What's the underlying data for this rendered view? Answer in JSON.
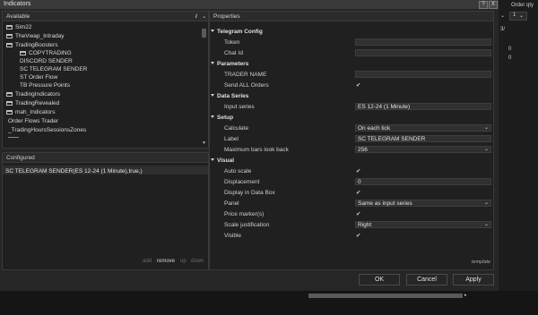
{
  "window": {
    "title": "Indicators",
    "help_label": "?",
    "close_label": "X"
  },
  "right_strip": {
    "order_qty_label": "Order qty",
    "qty_value": "1",
    "rows": [
      "3/",
      "0",
      "0"
    ]
  },
  "available": {
    "header": "Available",
    "header_icon": "i-info-icon",
    "items": [
      {
        "label": "Sim22",
        "folder": true
      },
      {
        "label": "TheVwap_Intraday",
        "folder": true
      },
      {
        "label": "TradingBoosters",
        "folder": true
      },
      {
        "label": "COPYTRADING",
        "folder": true
      },
      {
        "label": "DISCORD SENDER",
        "folder": false
      },
      {
        "label": "SC TELEGRAM SENDER",
        "folder": false
      },
      {
        "label": "ST Order Flow",
        "folder": false
      },
      {
        "label": "TB Pressure Points",
        "folder": false
      },
      {
        "label": "TradingIndicators",
        "folder": true
      },
      {
        "label": "TradingRevealed",
        "folder": true
      },
      {
        "label": "mah_Indicators",
        "folder": true
      },
      {
        "label": "Order Flows Trader",
        "folder": false
      },
      {
        "label": "_TradingHoursSessionsZones",
        "folder": false
      }
    ]
  },
  "configured": {
    "header": "Configured",
    "items": [
      "SC TELEGRAM SENDER(ES 12-24 (1 Minute),true,)"
    ],
    "actions": {
      "add": "add",
      "remove": "remove",
      "up": "up",
      "down": "down"
    }
  },
  "properties": {
    "header": "Properties",
    "groups": [
      {
        "name": "Telegram Config",
        "items": [
          {
            "label": "Token",
            "type": "text",
            "value": ""
          },
          {
            "label": "Chat Id",
            "type": "text",
            "value": ""
          }
        ]
      },
      {
        "name": "Parameters",
        "items": [
          {
            "label": "TRADER NAME",
            "type": "text",
            "value": ""
          },
          {
            "label": "Send ALL Orders",
            "type": "check",
            "value": "✔"
          }
        ]
      },
      {
        "name": "Data Series",
        "items": [
          {
            "label": "Input series",
            "type": "text",
            "value": "ES 12-24 (1 Minute)"
          }
        ]
      },
      {
        "name": "Setup",
        "items": [
          {
            "label": "Calculate",
            "type": "select",
            "value": "On each tick"
          },
          {
            "label": "Label",
            "type": "text",
            "value": "SC TELEGRAM SENDER"
          },
          {
            "label": "Maximum bars look back",
            "type": "select",
            "value": "256"
          }
        ]
      },
      {
        "name": "Visual",
        "items": [
          {
            "label": "Auto scale",
            "type": "check",
            "value": "✔"
          },
          {
            "label": "Displacement",
            "type": "text",
            "value": "0"
          },
          {
            "label": "Display in Data Box",
            "type": "check",
            "value": "✔"
          },
          {
            "label": "Panel",
            "type": "select",
            "value": "Same as input series"
          },
          {
            "label": "Price marker(s)",
            "type": "check",
            "value": "✔"
          },
          {
            "label": "Scale justification",
            "type": "select",
            "value": "Right"
          },
          {
            "label": "Visible",
            "type": "check",
            "value": "✔"
          }
        ]
      }
    ],
    "template_label": "template"
  },
  "buttons": {
    "ok": "OK",
    "cancel": "Cancel",
    "apply": "Apply"
  },
  "glyphs": {
    "caret": "⌄"
  }
}
